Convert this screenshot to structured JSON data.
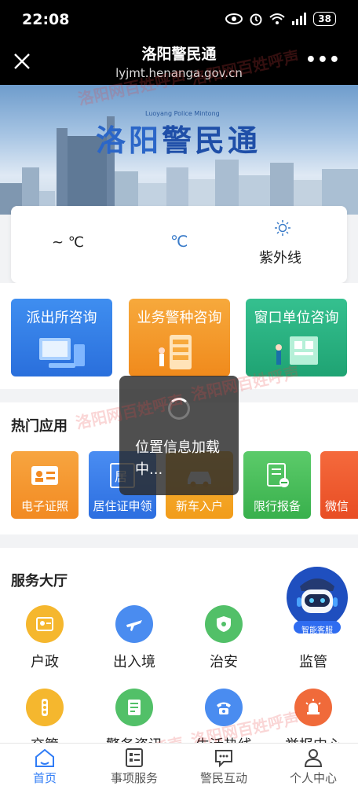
{
  "status_bar": {
    "time": "22:08",
    "battery": "38"
  },
  "header": {
    "title": "洛阳警民通",
    "url": "lyjmt.henanga.gov.cn"
  },
  "banner": {
    "logo_cn_1": "洛阳",
    "logo_cn_2": "警民通",
    "logo_en": "Luoyang Police Mintong"
  },
  "weather": {
    "temp": "~ ℃",
    "temp2": "℃",
    "uv_label": "紫外线"
  },
  "consult": [
    {
      "label": "派出所咨询"
    },
    {
      "label": "业务警种咨询"
    },
    {
      "label": "窗口单位咨询"
    }
  ],
  "hot_apps": {
    "title": "热门应用",
    "items": [
      {
        "label": "电子证照",
        "icon": "id-card-icon"
      },
      {
        "label": "居住证申领",
        "icon": "residence-permit-icon",
        "icon_char": "居"
      },
      {
        "label": "新车入户",
        "icon": "car-icon"
      },
      {
        "label": "限行报备",
        "icon": "restriction-report-icon"
      },
      {
        "label": "微信",
        "icon": "wechat-icon"
      }
    ]
  },
  "loading": {
    "message": "位置信息加载中..."
  },
  "service_hall": {
    "title": "服务大厅",
    "items": [
      {
        "label": "户政",
        "color": "#f5b72e"
      },
      {
        "label": "出入境",
        "color": "#4a8cf0"
      },
      {
        "label": "治安",
        "color": "#52c068"
      },
      {
        "label": "监管",
        "color": "#f07a3a"
      },
      {
        "label": "交管",
        "color": "#f5b72e"
      },
      {
        "label": "警务资讯",
        "color": "#52c068"
      },
      {
        "label": "生活热线",
        "color": "#4a8cf0"
      },
      {
        "label": "举报中心",
        "color": "#f06a3a"
      }
    ]
  },
  "robot": {
    "label": "智能客服"
  },
  "watermark": {
    "text1": "洛阳网",
    "text2": "百姓呼声"
  },
  "bottom_nav": [
    {
      "label": "首页",
      "active": true
    },
    {
      "label": "事项服务"
    },
    {
      "label": "警民互动"
    },
    {
      "label": "个人中心"
    }
  ],
  "colors": {
    "accent": "#2f7cf6",
    "header_bg": "#000000"
  }
}
